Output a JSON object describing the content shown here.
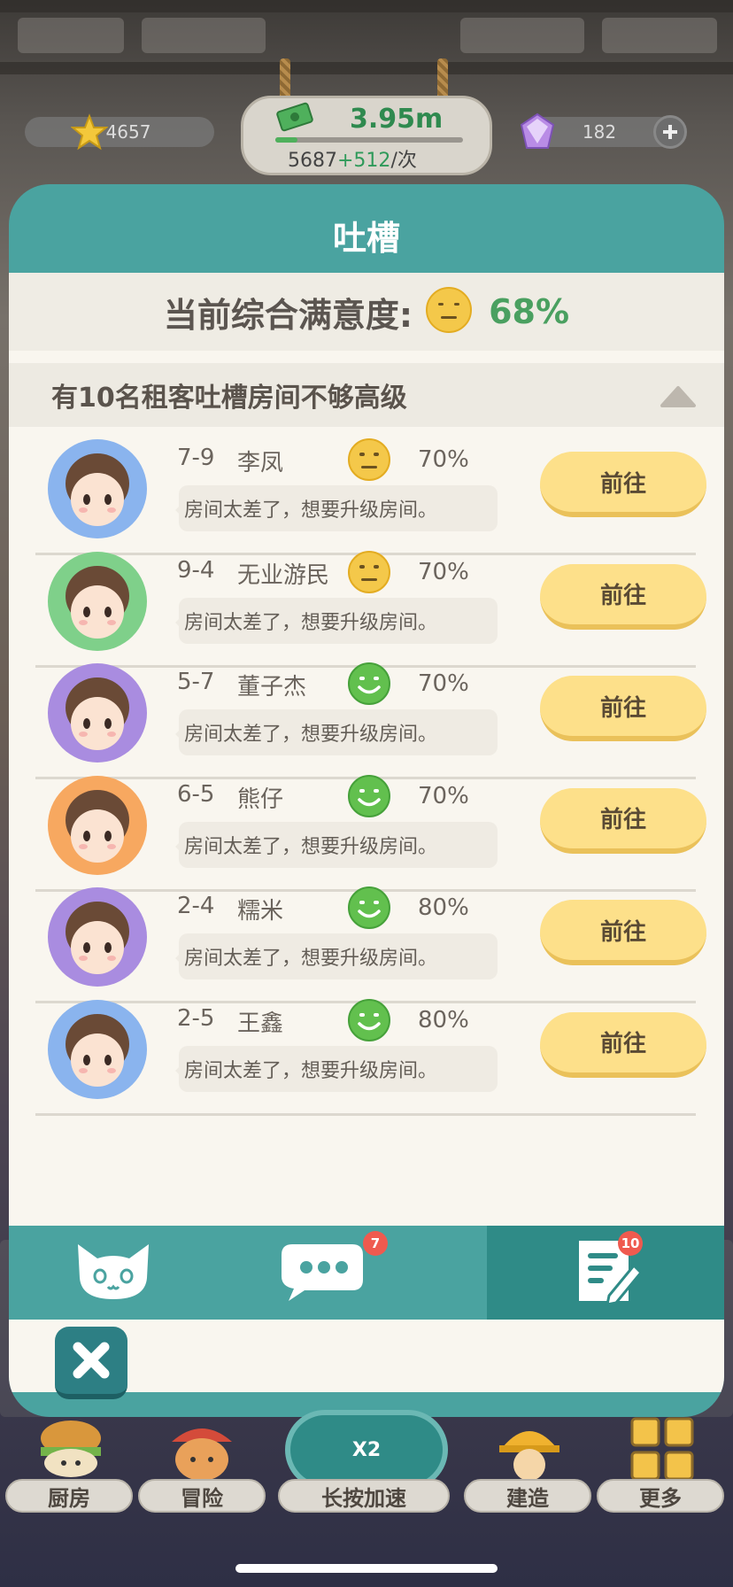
{
  "hud": {
    "stars": "4657",
    "money": "3.95m",
    "money_progress": 0.12,
    "income_base": "5687",
    "income_bonus": "+512",
    "income_unit": "/次",
    "gems": "182"
  },
  "dialog": {
    "title": "吐槽",
    "satisfaction_label": "当前综合满意度:",
    "satisfaction_face": "neutral-yellow",
    "satisfaction_pct": "68%",
    "section_title": "有10名租客吐槽房间不够高级",
    "tenants": [
      {
        "room": "7-9",
        "name": "李凤",
        "mood": "neutral-yellow",
        "pct": "70%",
        "complaint": "房间太差了，想要升级房间。",
        "button": "前往",
        "avatar_bg": "#8ab4ee"
      },
      {
        "room": "9-4",
        "name": "无业游民",
        "mood": "neutral-yellow",
        "pct": "70%",
        "complaint": "房间太差了，想要升级房间。",
        "button": "前往",
        "avatar_bg": "#7fd08a"
      },
      {
        "room": "5-7",
        "name": "董子杰",
        "mood": "happy-green",
        "pct": "70%",
        "complaint": "房间太差了，想要升级房间。",
        "button": "前往",
        "avatar_bg": "#a98ce0"
      },
      {
        "room": "6-5",
        "name": "熊仔",
        "mood": "happy-green",
        "pct": "70%",
        "complaint": "房间太差了，想要升级房间。",
        "button": "前往",
        "avatar_bg": "#f7a860"
      },
      {
        "room": "2-4",
        "name": "糯米",
        "mood": "happy-green",
        "pct": "80%",
        "complaint": "房间太差了，想要升级房间。",
        "button": "前往",
        "avatar_bg": "#a98ce0"
      },
      {
        "room": "2-5",
        "name": "王鑫",
        "mood": "happy-green",
        "pct": "80%",
        "complaint": "房间太差了，想要升级房间。",
        "button": "前往",
        "avatar_bg": "#8ab4ee"
      }
    ],
    "tabs": [
      {
        "icon": "cat-icon",
        "badge": ""
      },
      {
        "icon": "chat-icon",
        "badge": "7"
      },
      {
        "icon": "memo-icon",
        "badge": "10",
        "active": true
      }
    ]
  },
  "bottom_nav": {
    "kitchen": "厨房",
    "adventure": "冒险",
    "speed_up": "长按加速",
    "speed_multiplier": "X2",
    "build": "建造",
    "more": "更多"
  },
  "colors": {
    "teal": "#4aa3a0",
    "teal_dark": "#2f8b87",
    "button_yellow": "#fde08a",
    "satisfaction_green": "#4aa060"
  }
}
